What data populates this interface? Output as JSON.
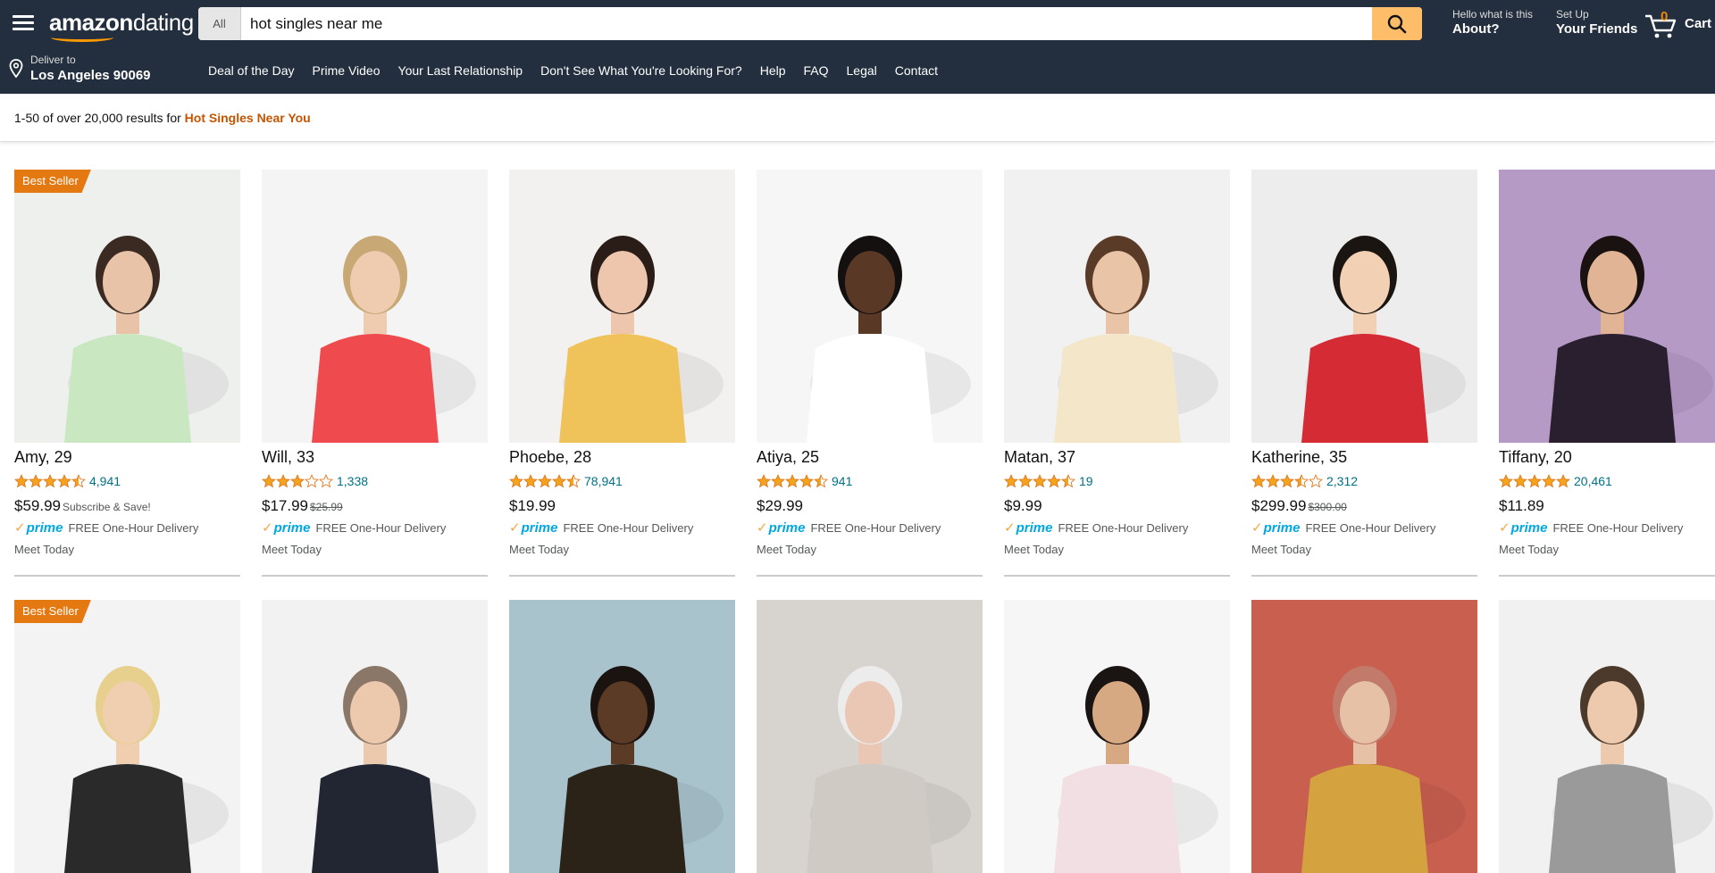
{
  "header": {
    "logo_main": "amazon",
    "logo_sub": "dating",
    "search_category": "All",
    "search_value": "hot singles near me",
    "about_small": "Hello what is this",
    "about_big": "About?",
    "friends_small": "Set Up",
    "friends_big": "Your Friends",
    "cart_count": "0",
    "cart_label": "Cart"
  },
  "subbar": {
    "deliver_small": "Deliver to",
    "deliver_big": "Los Angeles 90069",
    "links": [
      "Deal of the Day",
      "Prime Video",
      "Your Last Relationship",
      "Don't See What You're Looking For?",
      "Help",
      "FAQ",
      "Legal",
      "Contact"
    ]
  },
  "results": {
    "prefix": "1-50 of over 20,000 results for ",
    "query": "Hot Singles Near You"
  },
  "colors": {
    "header_bg": "#232f3e",
    "search_button": "#febd69",
    "badge": "#e47911",
    "link": "#007185",
    "prime": "#00a8e1",
    "star": "#f4a41c"
  },
  "listings": [
    {
      "name": "Amy, 29",
      "badge": "Best Seller",
      "rating": 4.5,
      "reviews": "4,941",
      "price": "$59.99",
      "price_note": "Subscribe & Save!",
      "old_price": "",
      "prime_label": "prime",
      "delivery": "FREE One-Hour Delivery",
      "meet": "Meet Today"
    },
    {
      "name": "Will, 33",
      "badge": "",
      "rating": 3,
      "reviews": "1,338",
      "price": "$17.99",
      "price_note": "",
      "old_price": "$25.99",
      "prime_label": "prime",
      "delivery": "FREE One-Hour Delivery",
      "meet": "Meet Today"
    },
    {
      "name": "Phoebe, 28",
      "badge": "",
      "rating": 4.5,
      "reviews": "78,941",
      "price": "$19.99",
      "price_note": "",
      "old_price": "",
      "prime_label": "prime",
      "delivery": "FREE One-Hour Delivery",
      "meet": "Meet Today"
    },
    {
      "name": "Atiya, 25",
      "badge": "",
      "rating": 4.5,
      "reviews": "941",
      "price": "$29.99",
      "price_note": "",
      "old_price": "",
      "prime_label": "prime",
      "delivery": "FREE One-Hour Delivery",
      "meet": "Meet Today"
    },
    {
      "name": "Matan, 37",
      "badge": "",
      "rating": 4.5,
      "reviews": "19",
      "price": "$9.99",
      "price_note": "",
      "old_price": "",
      "prime_label": "prime",
      "delivery": "FREE One-Hour Delivery",
      "meet": "Meet Today"
    },
    {
      "name": "Katherine, 35",
      "badge": "",
      "rating": 3.5,
      "reviews": "2,312",
      "price": "$299.99",
      "price_note": "",
      "old_price": "$300.00",
      "prime_label": "prime",
      "delivery": "FREE One-Hour Delivery",
      "meet": "Meet Today"
    },
    {
      "name": "Tiffany, 20",
      "badge": "",
      "rating": 5,
      "reviews": "20,461",
      "price": "$11.89",
      "price_note": "",
      "old_price": "",
      "prime_label": "prime",
      "delivery": "FREE One-Hour Delivery",
      "meet": "Meet Today"
    }
  ],
  "second_row": [
    {
      "badge": "Best Seller"
    },
    {
      "badge": ""
    },
    {
      "badge": ""
    },
    {
      "badge": ""
    },
    {
      "badge": ""
    },
    {
      "badge": ""
    },
    {
      "badge": ""
    }
  ]
}
